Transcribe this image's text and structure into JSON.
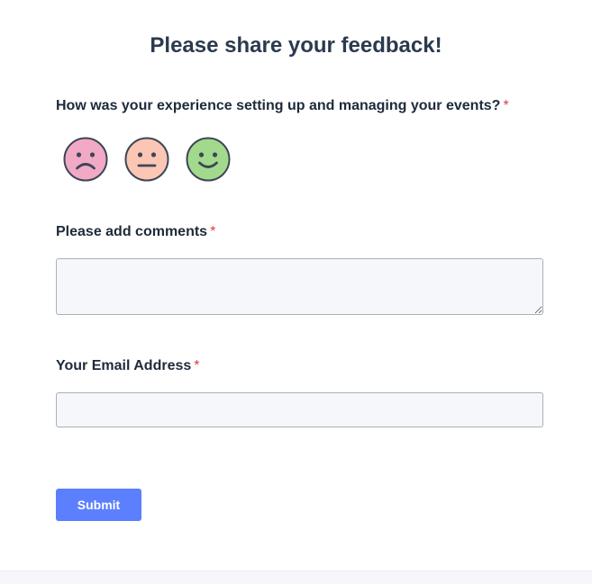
{
  "form": {
    "title": "Please share your feedback!",
    "experience_question": {
      "label": "How was your experience setting up and managing your events?",
      "required_mark": "*",
      "options": [
        {
          "icon": "sad-face-icon",
          "color": "#f2a9c6"
        },
        {
          "icon": "neutral-face-icon",
          "color": "#fcc6b4"
        },
        {
          "icon": "happy-face-icon",
          "color": "#a3d98c"
        }
      ]
    },
    "comments": {
      "label": "Please add comments",
      "required_mark": "*",
      "value": "",
      "placeholder": ""
    },
    "email": {
      "label": "Your Email Address",
      "required_mark": "*",
      "value": "",
      "placeholder": ""
    },
    "submit_label": "Submit"
  },
  "colors": {
    "accent": "#5b7ffd",
    "required": "#e03a3a",
    "field_background": "#f5f7fa",
    "face_stroke": "#3c4656"
  }
}
